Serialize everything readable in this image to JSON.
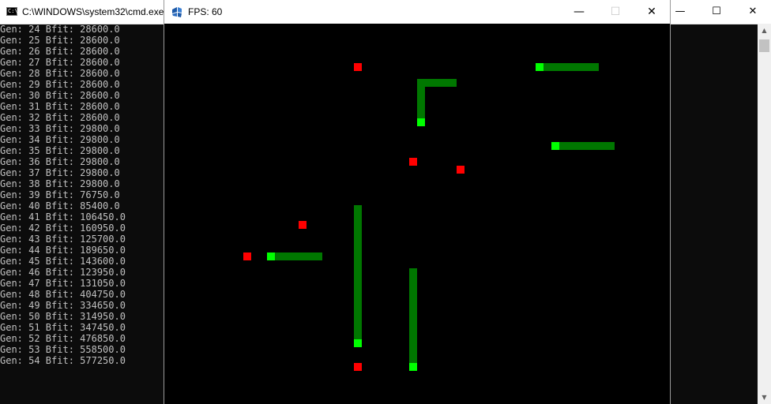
{
  "cmd": {
    "title": "C:\\WINDOWS\\system32\\cmd.exe",
    "icon_text": "C:\\_",
    "minimize": "—",
    "maximize": "☐",
    "close": "✕",
    "scroll_up": "▲",
    "scroll_down": "▼",
    "log": [
      "Gen: 24 Bfit: 28600.0",
      "Gen: 25 Bfit: 28600.0",
      "Gen: 26 Bfit: 28600.0",
      "Gen: 27 Bfit: 28600.0",
      "Gen: 28 Bfit: 28600.0",
      "Gen: 29 Bfit: 28600.0",
      "Gen: 30 Bfit: 28600.0",
      "Gen: 31 Bfit: 28600.0",
      "Gen: 32 Bfit: 28600.0",
      "Gen: 33 Bfit: 29800.0",
      "Gen: 34 Bfit: 29800.0",
      "Gen: 35 Bfit: 29800.0",
      "Gen: 36 Bfit: 29800.0",
      "Gen: 37 Bfit: 29800.0",
      "Gen: 38 Bfit: 29800.0",
      "Gen: 39 Bfit: 76750.0",
      "Gen: 40 Bfit: 85400.0",
      "Gen: 41 Bfit: 106450.0",
      "Gen: 42 Bfit: 160950.0",
      "Gen: 43 Bfit: 125700.0",
      "Gen: 44 Bfit: 189650.0",
      "Gen: 45 Bfit: 143600.0",
      "Gen: 46 Bfit: 123950.0",
      "Gen: 47 Bfit: 131050.0",
      "Gen: 48 Bfit: 404750.0",
      "Gen: 49 Bfit: 334650.0",
      "Gen: 50 Bfit: 314950.0",
      "Gen: 51 Bfit: 347450.0",
      "Gen: 52 Bfit: 476850.0",
      "Gen: 53 Bfit: 558500.0",
      "Gen: 54 Bfit: 577250.0"
    ]
  },
  "game": {
    "title": "FPS: 60",
    "minimize": "—",
    "maximize": "☐",
    "close": "✕",
    "grid_cols": 64,
    "grid_rows": 48,
    "colors": {
      "food": "#ff0000",
      "snake_head": "#00ff00",
      "snake_body": "#007700"
    },
    "food": [
      [
        24,
        5
      ],
      [
        37,
        18
      ],
      [
        31,
        17
      ],
      [
        17,
        25
      ],
      [
        10,
        29
      ],
      [
        24,
        43
      ]
    ],
    "snakes": [
      {
        "head": [
          47,
          5
        ],
        "body": [
          [
            48,
            5
          ],
          [
            49,
            5
          ],
          [
            50,
            5
          ],
          [
            51,
            5
          ],
          [
            52,
            5
          ],
          [
            53,
            5
          ],
          [
            54,
            5
          ]
        ]
      },
      {
        "head": [
          32,
          12
        ],
        "body": [
          [
            32,
            11
          ],
          [
            32,
            10
          ],
          [
            32,
            9
          ],
          [
            32,
            8
          ],
          [
            33,
            7
          ],
          [
            32,
            7
          ],
          [
            34,
            7
          ],
          [
            35,
            7
          ],
          [
            36,
            7
          ]
        ]
      },
      {
        "head": [
          49,
          15
        ],
        "body": [
          [
            50,
            15
          ],
          [
            51,
            15
          ],
          [
            52,
            15
          ],
          [
            53,
            15
          ],
          [
            54,
            15
          ],
          [
            55,
            15
          ],
          [
            56,
            15
          ]
        ]
      },
      {
        "head": [
          13,
          29
        ],
        "body": [
          [
            14,
            29
          ],
          [
            15,
            29
          ],
          [
            16,
            29
          ],
          [
            17,
            29
          ],
          [
            18,
            29
          ],
          [
            19,
            29
          ]
        ]
      },
      {
        "head": [
          24,
          40
        ],
        "body": [
          [
            24,
            23
          ],
          [
            24,
            24
          ],
          [
            24,
            25
          ],
          [
            24,
            26
          ],
          [
            24,
            27
          ],
          [
            24,
            28
          ],
          [
            24,
            29
          ],
          [
            24,
            30
          ],
          [
            24,
            31
          ],
          [
            24,
            32
          ],
          [
            24,
            33
          ],
          [
            24,
            34
          ],
          [
            24,
            35
          ],
          [
            24,
            36
          ],
          [
            24,
            37
          ],
          [
            24,
            38
          ],
          [
            24,
            39
          ]
        ]
      },
      {
        "head": [
          31,
          43
        ],
        "body": [
          [
            31,
            31
          ],
          [
            31,
            32
          ],
          [
            31,
            33
          ],
          [
            31,
            34
          ],
          [
            31,
            35
          ],
          [
            31,
            36
          ],
          [
            31,
            37
          ],
          [
            31,
            38
          ],
          [
            31,
            39
          ],
          [
            31,
            40
          ],
          [
            31,
            41
          ],
          [
            31,
            42
          ]
        ]
      }
    ]
  }
}
